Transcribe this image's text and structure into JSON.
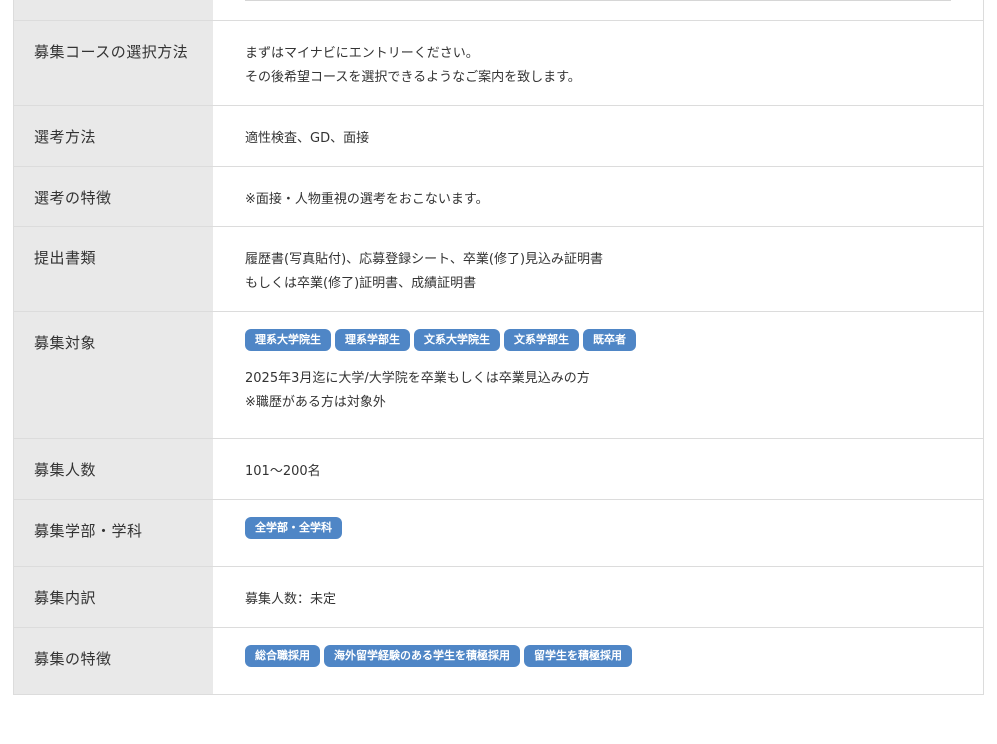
{
  "rows": [
    {
      "label": "募集コースの選択方法",
      "lines": [
        "まずはマイナビにエントリーください。",
        "その後希望コースを選択できるようなご案内を致します。"
      ]
    },
    {
      "label": "選考方法",
      "lines": [
        "適性検査、GD、面接"
      ]
    },
    {
      "label": "選考の特徴",
      "lines": [
        "※面接・人物重視の選考をおこないます。"
      ]
    },
    {
      "label": "提出書類",
      "lines": [
        "履歴書(写真貼付)、応募登録シート、卒業(修了)見込み証明書",
        "もしくは卒業(修了)証明書、成績証明書"
      ]
    },
    {
      "label": "募集対象",
      "tags": [
        "理系大学院生",
        "理系学部生",
        "文系大学院生",
        "文系学部生",
        "既卒者"
      ],
      "lines": [
        "2025年3月迄に大学/大学院を卒業もしくは卒業見込みの方",
        "※職歴がある方は対象外"
      ]
    },
    {
      "label": "募集人数",
      "lines": [
        "101～200名"
      ]
    },
    {
      "label": "募集学部・学科",
      "tags": [
        "全学部・全学科"
      ]
    },
    {
      "label": "募集内訳",
      "lines": [
        "募集人数：未定"
      ]
    },
    {
      "label": "募集の特徴",
      "tags": [
        "総合職採用",
        "海外留学経験のある学生を積極採用",
        "留学生を積極採用"
      ]
    }
  ],
  "colors": {
    "tag_bg": "#4f86c6",
    "header_bg": "#e9e9e9",
    "border": "#dcdcdc"
  }
}
